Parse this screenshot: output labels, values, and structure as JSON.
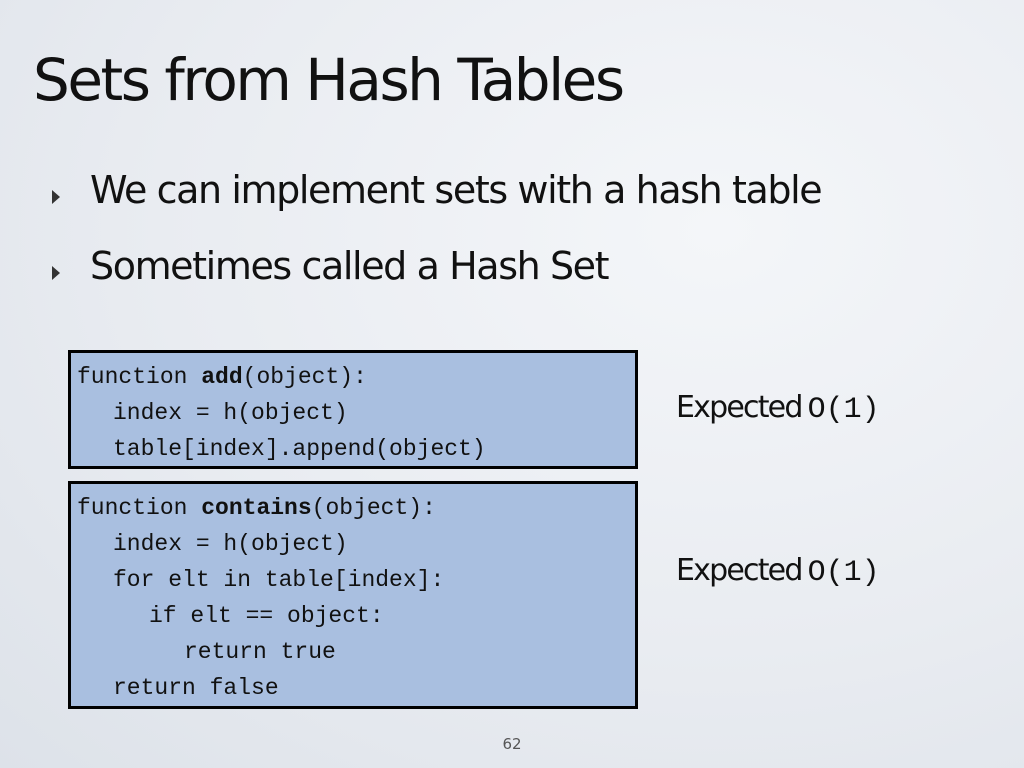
{
  "title": "Sets from Hash Tables",
  "bullets": [
    "We can implement sets with a hash table",
    "Sometimes called a Hash Set"
  ],
  "code_add": {
    "line1_pre": "function ",
    "line1_name": "add",
    "line1_post": "(object):",
    "line2": "index = h(object)",
    "line3": "table[index].append(object)"
  },
  "code_contains": {
    "line1_pre": "function ",
    "line1_name": "contains",
    "line1_post": "(object):",
    "line2": "index = h(object)",
    "line3": "for elt in table[index]:",
    "line4": "if elt == object:",
    "line5": "return true",
    "line6": "return false"
  },
  "expected": {
    "label": "Expected",
    "add_complexity": "O(1)",
    "contains_complexity": "O(1)"
  },
  "page_number": "62"
}
